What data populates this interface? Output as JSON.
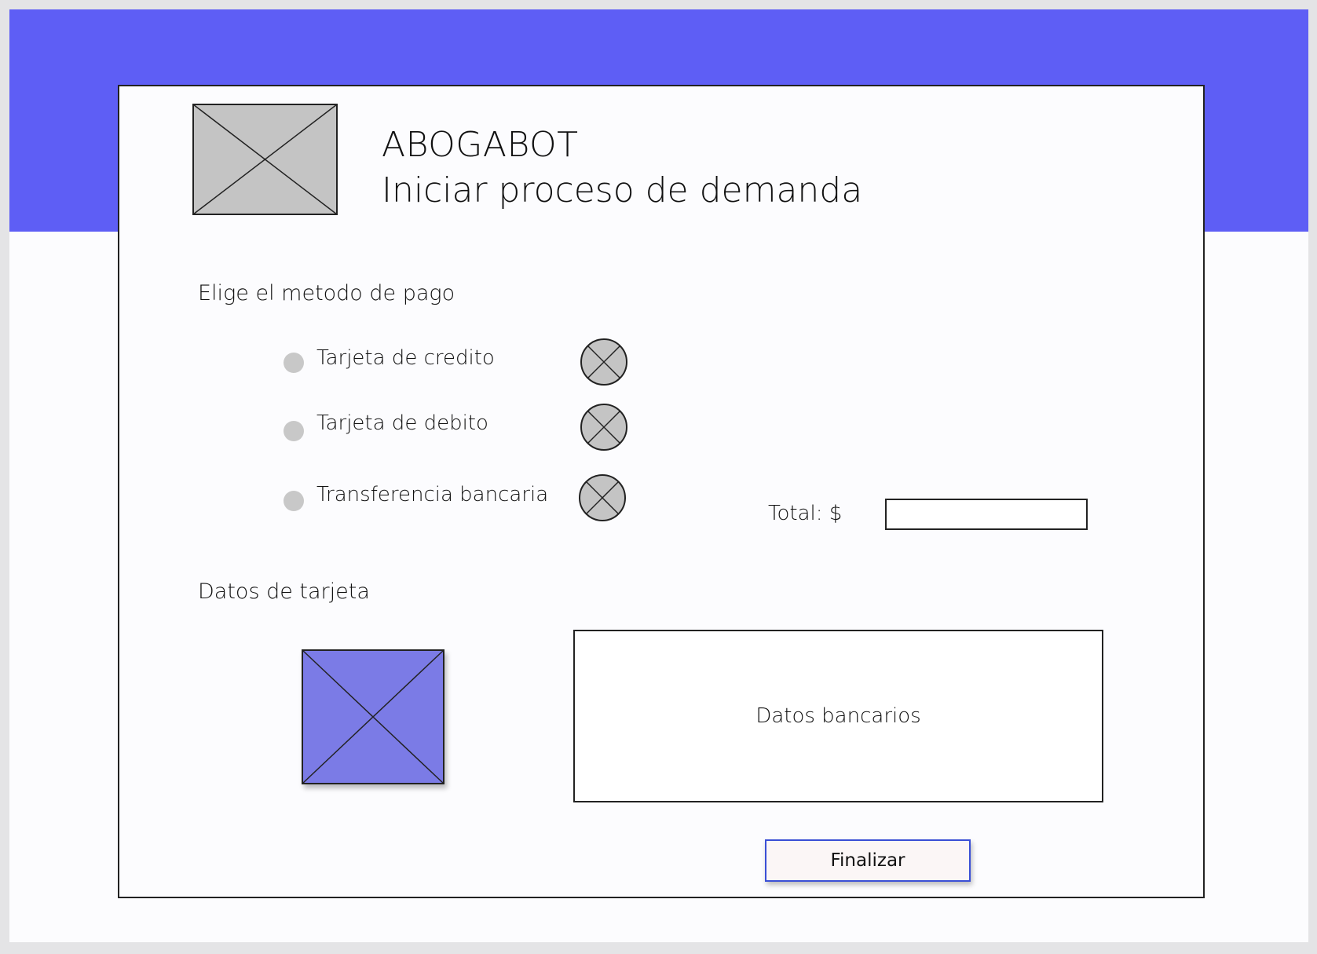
{
  "header": {
    "brand": "ABOGABOT",
    "subtitle": "Iniciar proceso de demanda",
    "logo_icon": "image-placeholder-icon",
    "banner_color": "#5e5ef5"
  },
  "payment": {
    "heading": "Elige el metodo de pago",
    "options": [
      {
        "label": "Tarjeta de credito",
        "icon": "image-placeholder-icon"
      },
      {
        "label": "Tarjeta de debito",
        "icon": "image-placeholder-icon"
      },
      {
        "label": "Transferencia bancaria",
        "icon": "image-placeholder-icon"
      }
    ],
    "total_label": "Total: $",
    "total_value": ""
  },
  "card_data": {
    "heading": "Datos de tarjeta",
    "image_icon": "card-image-placeholder-icon",
    "image_color": "#7b7be6",
    "bank_box_text": "Datos bancarios"
  },
  "actions": {
    "finish_label": "Finalizar",
    "finish_border_color": "#3a4fd6"
  }
}
